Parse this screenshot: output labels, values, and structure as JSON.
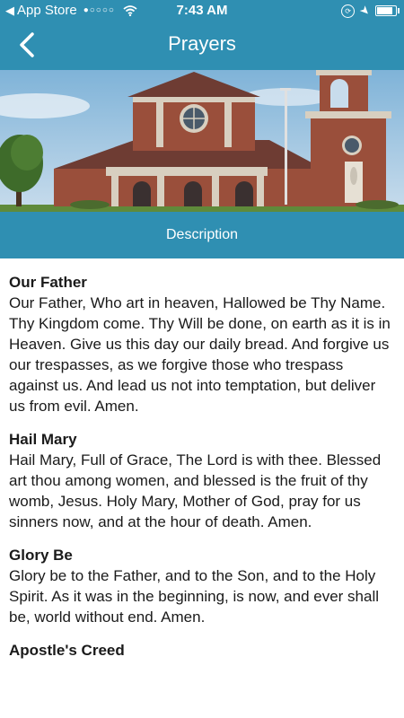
{
  "status_bar": {
    "back_app": "App Store",
    "signal": "●○○○○",
    "time": "7:43 AM",
    "battery_level": 0.95
  },
  "nav": {
    "title": "Prayers"
  },
  "description_button": "Description",
  "prayers": [
    {
      "title": "Our Father",
      "text": "Our Father, Who art in heaven, Hallowed be Thy Name. Thy Kingdom come. Thy Will be done, on earth as it is in Heaven. Give us this day our daily bread. And forgive us our trespasses, as we forgive those who trespass against us. And lead us not into temptation, but deliver us from evil. Amen."
    },
    {
      "title": "Hail Mary",
      "text": "Hail Mary, Full of Grace, The Lord is with thee. Blessed art thou among women, and blessed is the fruit of thy womb, Jesus. Holy Mary, Mother of God, pray for us sinners now, and at the hour of death. Amen."
    },
    {
      "title": "Glory Be",
      "text": "Glory be to the Father, and to the Son, and to the Holy Spirit. As it was in the beginning, is now, and ever shall be, world without end. Amen."
    },
    {
      "title": "Apostle's Creed",
      "text": ""
    }
  ],
  "colors": {
    "header": "#2f8fb2",
    "text": "#1a1a1a"
  }
}
